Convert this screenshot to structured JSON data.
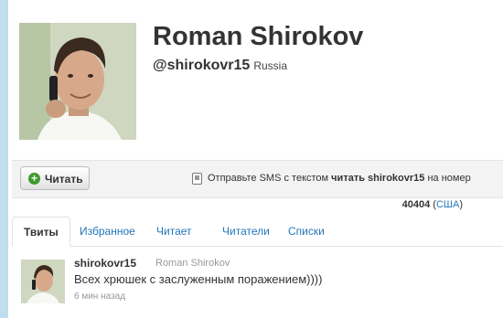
{
  "profile": {
    "name": "Roman Shirokov",
    "handle": "@shirokovr15",
    "location": "Russia"
  },
  "follow_button": {
    "label": "Читать",
    "icon": "plus-icon"
  },
  "sms": {
    "prefix": "Отправьте SMS с текстом",
    "command": "читать shirokovr15",
    "suffix": "на номер",
    "number": "40404",
    "country_open": "(",
    "country": "США",
    "country_close": ")"
  },
  "tabs": [
    {
      "label": "Твиты",
      "active": true
    },
    {
      "label": "Избранное"
    },
    {
      "label": "Читает"
    },
    {
      "label": "Читатели"
    },
    {
      "label": "Списки"
    }
  ],
  "tweet": {
    "username": "shirokovr15",
    "fullname": "Roman Shirokov",
    "text": "Всех хрюшек с заслуженным поражением))))",
    "time": "6 мин назад"
  },
  "colors": {
    "background": "#c0deed",
    "link": "#2276bb",
    "follow_icon": "#3f9a2c"
  }
}
